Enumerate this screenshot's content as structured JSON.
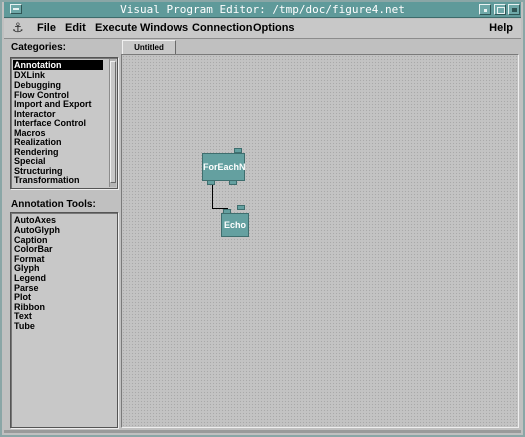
{
  "window": {
    "title": "Visual Program Editor: /tmp/doc/figure4.net"
  },
  "menubar": {
    "items": [
      {
        "label": "File"
      },
      {
        "label": "Edit"
      },
      {
        "label": "Execute"
      },
      {
        "label": "Windows"
      },
      {
        "label": "Connection"
      },
      {
        "label": "Options"
      }
    ],
    "help": "Help"
  },
  "categories": {
    "label": "Categories:",
    "items": [
      "Annotation",
      "DXLink",
      "Debugging",
      "Flow Control",
      "Import and Export",
      "Interactor",
      "Interface Control",
      "Macros",
      "Realization",
      "Rendering",
      "Special",
      "Structuring",
      "Transformation"
    ],
    "selected": "Annotation"
  },
  "tools": {
    "label": "Annotation Tools:",
    "items": [
      "AutoAxes",
      "AutoGlyph",
      "Caption",
      "ColorBar",
      "Format",
      "Glyph",
      "Legend",
      "Parse",
      "Plot",
      "Ribbon",
      "Text",
      "Tube"
    ]
  },
  "editor": {
    "tab": "Untitled",
    "nodes": [
      {
        "label": "ForEachN"
      },
      {
        "label": "Echo"
      }
    ]
  },
  "icons": {
    "window_menu": "anchor-icon",
    "minimize": "minimize-icon",
    "maximize": "maximize-icon",
    "close": "close-icon"
  },
  "colors": {
    "titlebar": "#5f9a9a",
    "node": "#64a0a0",
    "selection": "#000000"
  }
}
